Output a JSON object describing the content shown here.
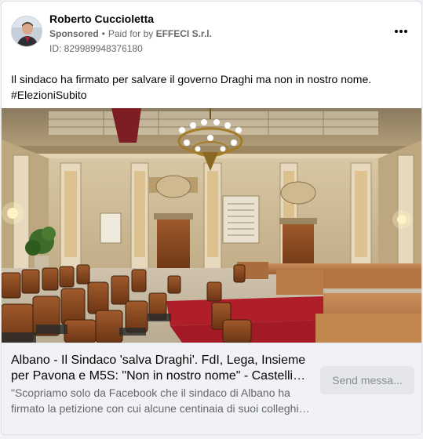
{
  "post": {
    "author": "Roberto Cuccioletta",
    "sponsored": "Sponsored",
    "separator": "•",
    "paid_for_prefix": "Paid for by",
    "payer": "EFFECI S.r.l.",
    "ad_id": "ID: 829989948376180",
    "more_icon": "more-horizontal-icon",
    "text_line1": "Il sindaco ha firmato per salvare il governo Draghi ma non in nostro nome.",
    "hashtag": "#ElezioniSubito"
  },
  "link_preview": {
    "title": "Albano - Il Sindaco 'salva Draghi'. FdI, Lega, Insieme per Pavona e M5S: \"Non in nostro nome\" - Castelli Notizie",
    "description": "\"Scopriamo solo da Facebook che il sindaco di Albano ha firmato la petizione con cui alcune centinaia di suoi colleghi sindaci...",
    "cta_label": "Send messa..."
  },
  "colors": {
    "text_primary": "#050505",
    "text_secondary": "#65676b",
    "link_box_bg": "#f0f2f5",
    "button_bg": "#e4e6eb",
    "carpet_red": "#b01e2a"
  }
}
